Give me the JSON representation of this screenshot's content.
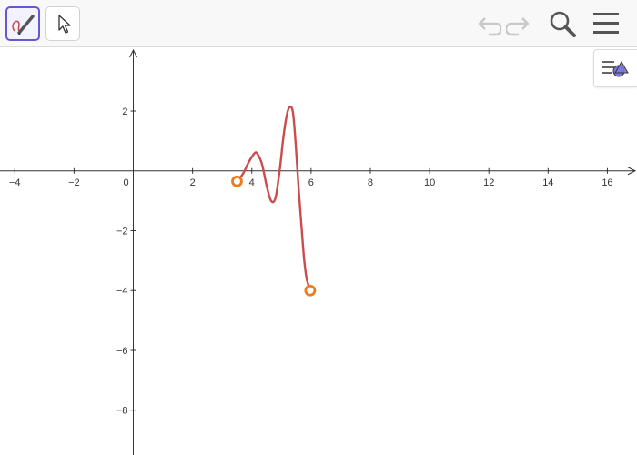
{
  "toolbar": {
    "tools": [
      {
        "icon": "freehand-pen-icon",
        "active": true
      },
      {
        "icon": "move-pointer-icon",
        "active": false
      }
    ],
    "actions": [
      "undo-icon",
      "redo-icon",
      "search-icon",
      "menu-icon"
    ]
  },
  "style_bar": {
    "icon": "style-bar-icon"
  },
  "colors": {
    "curve": "#cc4b4b",
    "endpoint": "#f07a1a",
    "active_tool": "#6557d2",
    "axis": "#333333"
  },
  "chart_data": {
    "type": "line",
    "xlim": [
      -4.5,
      17
    ],
    "ylim": [
      -9.5,
      4.1
    ],
    "x_ticks": [
      -4,
      -2,
      0,
      2,
      4,
      6,
      8,
      10,
      12,
      14,
      16
    ],
    "y_ticks": [
      -8,
      -6,
      -4,
      -2,
      2
    ],
    "x_tick_labels": [
      "−4",
      "−2",
      "0",
      "2",
      "4",
      "6",
      "8",
      "10",
      "12",
      "14",
      "16"
    ],
    "y_tick_labels": [
      "−8",
      "−6",
      "−4",
      "−2",
      "2"
    ],
    "grid": false,
    "series": [
      {
        "x": [
          3.5,
          3.7,
          3.9,
          4.1,
          4.2,
          4.35,
          4.5,
          4.65,
          4.8,
          4.95,
          5.05,
          5.15,
          5.25,
          5.38,
          5.48,
          5.58,
          5.68,
          5.76,
          5.84,
          5.92,
          5.97
        ],
        "y": [
          -0.35,
          -0.1,
          0.3,
          0.6,
          0.55,
          0.2,
          -0.5,
          -1.0,
          -0.9,
          0.1,
          1.0,
          1.7,
          2.1,
          2.0,
          0.9,
          -0.6,
          -1.9,
          -2.9,
          -3.55,
          -3.85,
          -4.0
        ]
      }
    ],
    "endpoints": [
      {
        "x": 3.5,
        "y": -0.35
      },
      {
        "x": 5.97,
        "y": -4.0
      }
    ]
  }
}
